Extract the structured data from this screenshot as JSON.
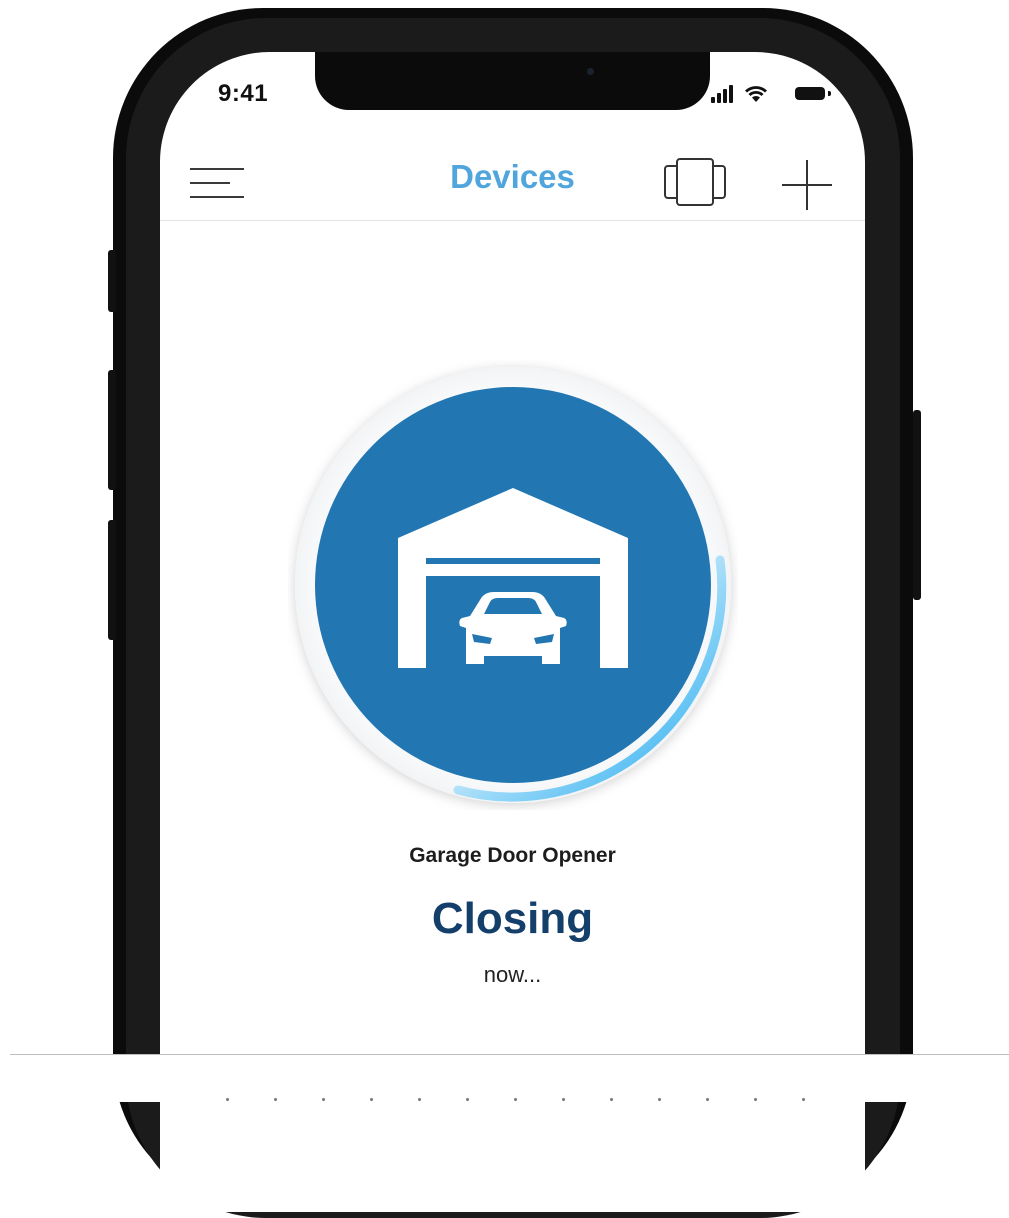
{
  "status_bar": {
    "time": "9:41"
  },
  "nav": {
    "title": "Devices",
    "menu_icon": "hamburger-menu-icon",
    "devices_icon": "device-cards-icon",
    "add_icon": "plus-icon"
  },
  "device": {
    "icon": "garage-car-icon",
    "name": "Garage Door Opener",
    "status": "Closing",
    "status_detail": "now..."
  },
  "colors": {
    "accent": "#4fa5dc",
    "control_fill": "#2277b3",
    "status_text": "#143f6b",
    "progress_ring": "#2bb3f0"
  }
}
